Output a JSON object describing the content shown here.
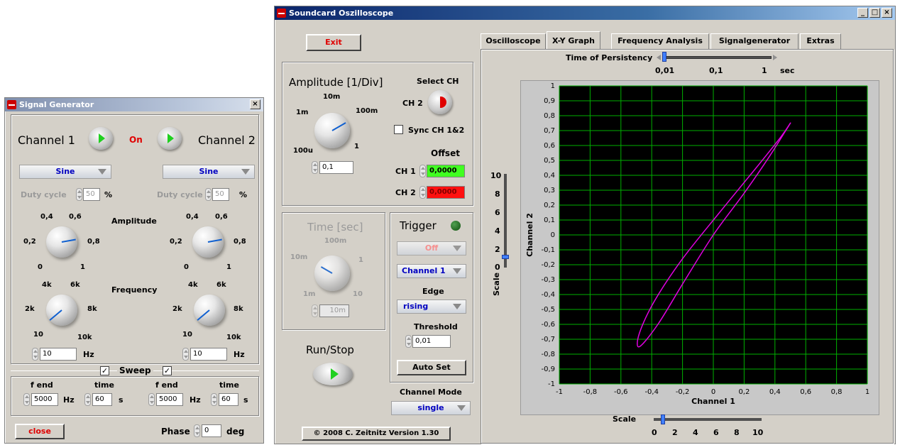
{
  "siggen": {
    "title": "Signal Generator",
    "close_x": "×",
    "ch1_label": "Channel 1",
    "on_label": "On",
    "ch2_label": "Channel 2",
    "waveform1": "Sine",
    "waveform2": "Sine",
    "duty_label": "Duty cycle",
    "duty1_value": "50",
    "duty2_value": "50",
    "percent": "%",
    "amp_label": "Amplitude",
    "amp_ticks": [
      "0,4",
      "0,6",
      "0,2",
      "0,8",
      "0",
      "1"
    ],
    "freq_label": "Frequency",
    "freq_ticks": [
      "4k",
      "6k",
      "2k",
      "8k",
      "10",
      "10k"
    ],
    "freq1_value": "10",
    "freq2_value": "10",
    "hz": "Hz",
    "sweep_label": "Sweep",
    "sweep1_check": "✓",
    "sweep2_check": "✓",
    "fend_label": "f end",
    "time_label": "time",
    "fend1": "5000",
    "time1": "60",
    "fend2": "5000",
    "time2": "60",
    "s": "s",
    "close_label": "close",
    "phase_label": "Phase",
    "phase_value": "0",
    "deg": "deg"
  },
  "osc": {
    "title": "Soundcard Oszilloscope",
    "win_buttons": [
      "_",
      "□",
      "×"
    ],
    "exit_label": "Exit",
    "amp_title": "Amplitude [1/Div]",
    "amp_ticks": [
      "10m",
      "1m",
      "100m",
      "100u",
      "1"
    ],
    "amp_value": "0,1",
    "select_ch_label": "Select CH",
    "ch2_label": "CH 2",
    "sync_label": "Sync CH 1&2",
    "offset_label": "Offset",
    "ch1_off_label": "CH 1",
    "ch1_offset": "0,0000",
    "ch2_off_label": "CH 2",
    "ch2_offset": "0,0000",
    "time_title": "Time [sec]",
    "time_ticks": [
      "100m",
      "10m",
      "1",
      "1m",
      "10"
    ],
    "time_value": "10m",
    "trigger_label": "Trigger",
    "trig_mode": "Off",
    "trig_channel": "Channel 1",
    "edge_label": "Edge",
    "edge_value": "rising",
    "threshold_label": "Threshold",
    "threshold_value": "0,01",
    "autoset_label": "Auto Set",
    "runstop_label": "Run/Stop",
    "chmode_label": "Channel Mode",
    "chmode_value": "single",
    "copyright": "© 2008  C. Zeitnitz Version 1.30",
    "tabs": [
      "Oscilloscope",
      "X-Y Graph",
      "Frequency Analysis",
      "Signalgenerator",
      "Extras"
    ],
    "persistency_label": "Time of Persistency",
    "persistency_ticks": [
      "0,01",
      "0,1",
      "1"
    ],
    "persistency_unit": "sec",
    "scale_label": "Scale",
    "vscale_ticks": [
      "10",
      "8",
      "6",
      "4",
      "2",
      "0"
    ],
    "hscale_ticks": [
      "0",
      "2",
      "4",
      "6",
      "8",
      "10"
    ]
  },
  "chart_data": {
    "type": "line",
    "xlabel": "Channel 1",
    "ylabel": "Channel 2",
    "xlim": [
      -1,
      1
    ],
    "ylim": [
      -1,
      1
    ],
    "xticks": [
      "-1",
      "-0,8",
      "-0,6",
      "-0,4",
      "-0,2",
      "0",
      "0,2",
      "0,4",
      "0,6",
      "0,8",
      "1"
    ],
    "yticks": [
      "1",
      "0,9",
      "0,8",
      "0,7",
      "0,6",
      "0,5",
      "0,4",
      "0,3",
      "0,2",
      "0,1",
      "0",
      "-0,1",
      "-0,2",
      "-0,3",
      "-0,4",
      "-0,5",
      "-0,6",
      "-0,7",
      "-0,8",
      "-0,9",
      "-1"
    ],
    "grid": true,
    "background": "#000000",
    "grid_color": "#00b000",
    "series": [
      {
        "color": "#e000e0",
        "x": [
          0.0,
          0.2,
          0.36,
          0.47,
          0.5,
          0.44,
          0.27,
          0.04,
          -0.2,
          -0.38,
          -0.48,
          -0.48,
          -0.36,
          -0.2,
          0.0
        ],
        "y": [
          0.0,
          0.28,
          0.52,
          0.7,
          0.75,
          0.66,
          0.44,
          0.15,
          -0.16,
          -0.44,
          -0.66,
          -0.75,
          -0.6,
          -0.33,
          0.0
        ]
      }
    ]
  }
}
